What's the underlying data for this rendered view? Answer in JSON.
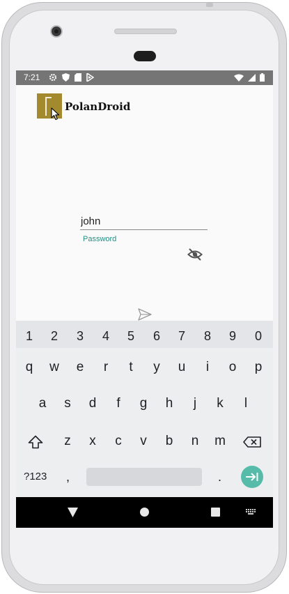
{
  "status_bar": {
    "time": "7:21",
    "left_icons": [
      "gear-icon",
      "shield-icon",
      "sd-card-icon",
      "play-protect-icon"
    ],
    "right_icons": [
      "wifi-icon",
      "cell-signal-icon",
      "battery-icon"
    ]
  },
  "app": {
    "title": "PolanDroid",
    "logo_color": "#a38a2f"
  },
  "login": {
    "username_value": "john",
    "password_label": "Password",
    "accent_color": "#2a8c82"
  },
  "keyboard": {
    "number_row": [
      "1",
      "2",
      "3",
      "4",
      "5",
      "6",
      "7",
      "8",
      "9",
      "0"
    ],
    "row1": [
      "q",
      "w",
      "e",
      "r",
      "t",
      "y",
      "u",
      "i",
      "o",
      "p"
    ],
    "row2": [
      "a",
      "s",
      "d",
      "f",
      "g",
      "h",
      "j",
      "k",
      "l"
    ],
    "row3": [
      "z",
      "x",
      "c",
      "v",
      "b",
      "n",
      "m"
    ],
    "symbols_label": "?123",
    "comma": ",",
    "period": ".",
    "enter_color": "#56bba9"
  },
  "nav_bar": {
    "buttons": [
      "back-icon",
      "home-icon",
      "recents-icon",
      "keyboard-switch-icon"
    ]
  }
}
